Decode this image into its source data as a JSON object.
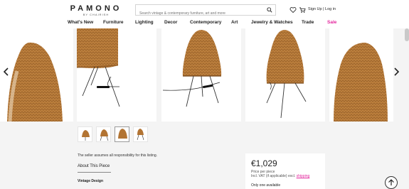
{
  "header": {
    "logo": "PAMONO",
    "logo_sub": "BY CHAIRISH",
    "search_placeholder": "Search vintage & contemporary furniture, art and more",
    "auth": "Sign Up | Log in"
  },
  "nav": [
    {
      "label": "What's New"
    },
    {
      "label": "Furniture"
    },
    {
      "label": "Lighting"
    },
    {
      "label": "Decor"
    },
    {
      "label": "Contemporary"
    },
    {
      "label": "Art"
    },
    {
      "label": "Jewelry & Watches"
    },
    {
      "label": "Trade"
    },
    {
      "label": "Sale"
    }
  ],
  "listing": {
    "seller_note": "The seller assumes all responsibility for this listing.",
    "about_title": "About This Piece",
    "design_label": "Vintage Design"
  },
  "price": {
    "amount": "€1,029",
    "per_piece": "Price per piece",
    "vat_prefix": "Incl. VAT (if applicable) excl.",
    "shipping": "shipping",
    "availability": "Only one available"
  },
  "colors": {
    "accent": "#e3259d",
    "wicker": "#b27433"
  },
  "icons": [
    "search-icon",
    "heart-icon",
    "cart-icon",
    "chevron-left-icon",
    "chevron-right-icon",
    "arrow-up-icon"
  ]
}
